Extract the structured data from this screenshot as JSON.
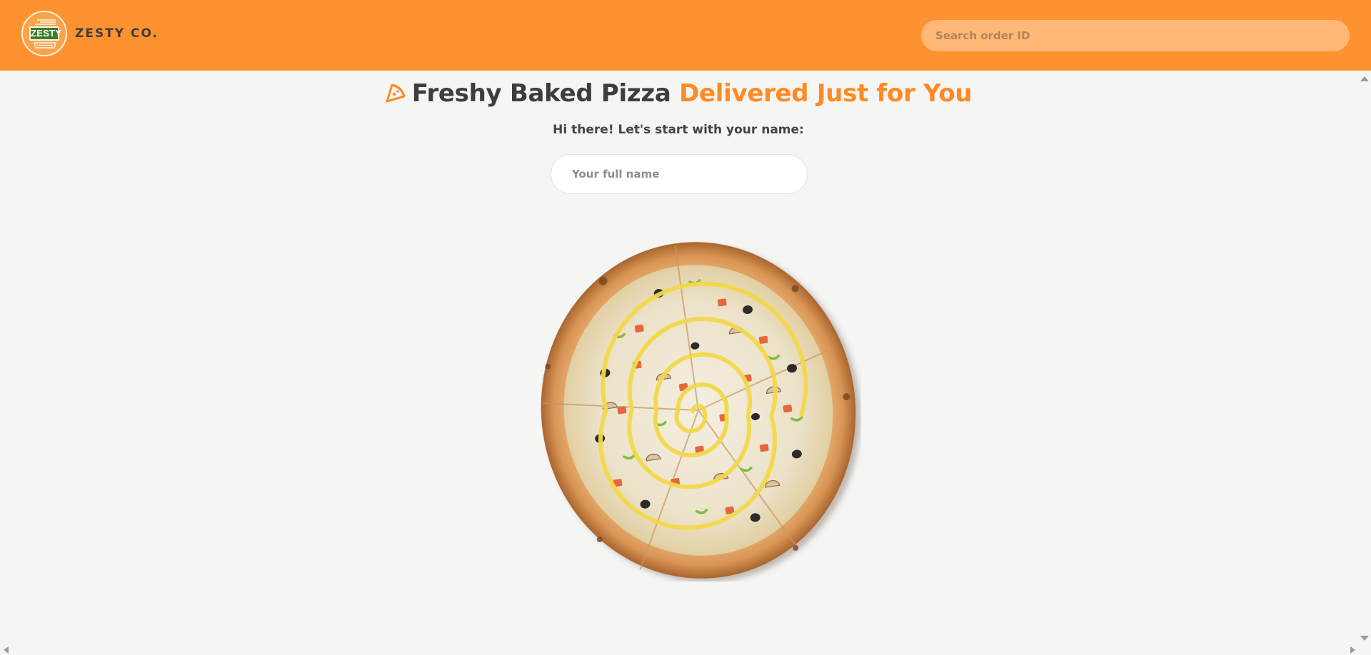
{
  "header": {
    "logo_text": "ZESTY",
    "brand_name": "ZESTY CO.",
    "search_placeholder": "Search order ID",
    "background_color": "#ff9230",
    "search_color": "#ffb877"
  },
  "hero": {
    "icon": "pizza-slice-icon",
    "title_part1": "Freshy Baked Pizza",
    "title_part2": "Delivered Just for You",
    "accent_color": "#ff8a25"
  },
  "form": {
    "prompt": "Hi there! Let's start with your name:",
    "name_placeholder": "Your full name"
  },
  "image": {
    "name": "pizza-image"
  },
  "scrollbars": {
    "vertical": [
      "scroll-up-arrow-icon",
      "scroll-down-arrow-icon"
    ],
    "horizontal": [
      "scroll-left-arrow-icon",
      "scroll-right-arrow-icon"
    ]
  }
}
